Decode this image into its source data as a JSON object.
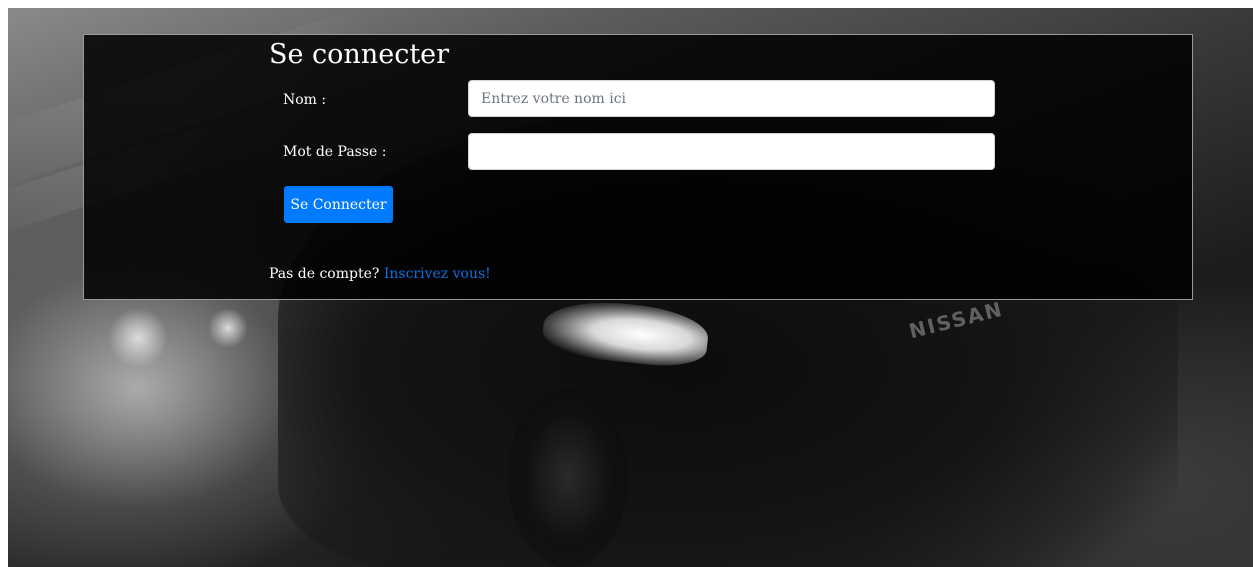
{
  "background": {
    "brand_text": "NISSAN"
  },
  "login": {
    "title": "Se connecter",
    "name_label": "Nom :",
    "name_placeholder": "Entrez votre nom ici",
    "name_value": "",
    "password_label": "Mot de Passe :",
    "password_value": "",
    "submit_label": "Se Connecter",
    "no_account_text": "Pas de compte?",
    "register_link": "Inscrivez vous!"
  },
  "colors": {
    "primary": "#007bff",
    "link": "#0f6fe0",
    "panel_border": "#9a9a9a"
  }
}
